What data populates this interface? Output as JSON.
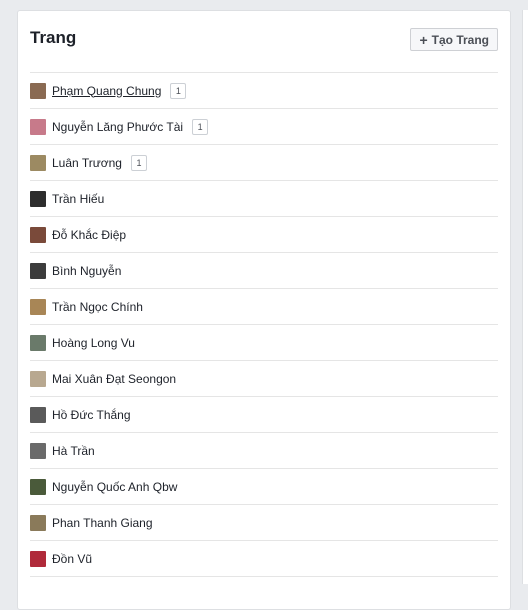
{
  "panel": {
    "title": "Trang",
    "create_button": {
      "icon": "plus-icon",
      "label": "Tạo Trang"
    }
  },
  "pages": [
    {
      "name": "Phạm Quang Chung",
      "badge": "1",
      "underlined": true,
      "avatar_color": "#8a6a52"
    },
    {
      "name": "Nguyễn Lăng Phước Tài",
      "badge": "1",
      "avatar_color": "#c77a8a"
    },
    {
      "name": "Luân Trương",
      "badge": "1",
      "avatar_color": "#9c8a62"
    },
    {
      "name": "Trần Hiếu",
      "avatar_color": "#2d2d2d"
    },
    {
      "name": "Đỗ Khắc Điệp",
      "avatar_color": "#7a4a3a"
    },
    {
      "name": "Bình Nguyễn",
      "avatar_color": "#3c3c3c"
    },
    {
      "name": "Trần Ngọc Chính",
      "avatar_color": "#a88656"
    },
    {
      "name": "Hoàng Long Vu",
      "avatar_color": "#6a7a6a"
    },
    {
      "name": "Mai Xuân Đạt Seongon",
      "avatar_color": "#b8a890"
    },
    {
      "name": "Hồ Đức Thắng",
      "avatar_color": "#5a5a5a"
    },
    {
      "name": "Hà Trần",
      "avatar_color": "#6a6a6a"
    },
    {
      "name": "Nguyễn Quốc Anh Qbw",
      "avatar_color": "#4a5a3a"
    },
    {
      "name": "Phan Thanh Giang",
      "avatar_color": "#8a7a5a"
    },
    {
      "name": "Đồn Vũ",
      "avatar_color": "#b02a3a"
    }
  ]
}
